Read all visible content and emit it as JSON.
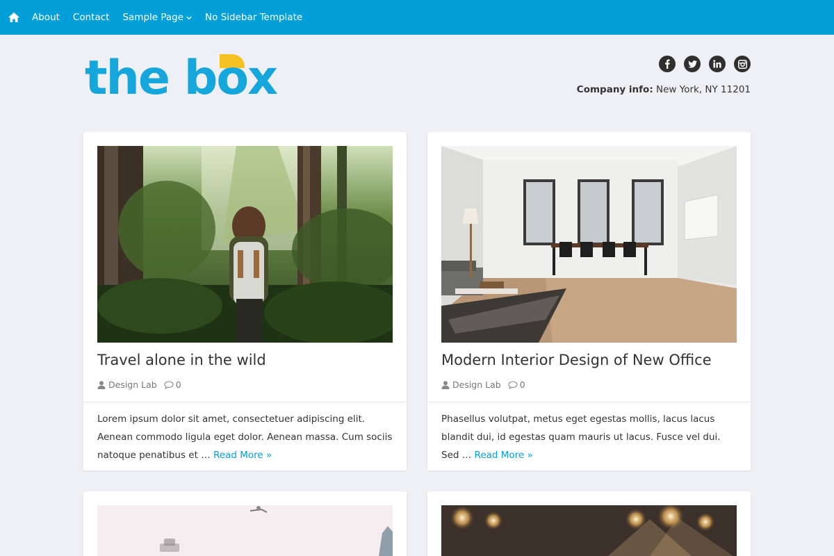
{
  "nav": {
    "home_icon": "home-icon",
    "items": [
      {
        "label": "About"
      },
      {
        "label": "Contact"
      },
      {
        "label": "Sample Page",
        "has_submenu": true
      },
      {
        "label": "No Sidebar Template"
      }
    ]
  },
  "header": {
    "logo_text": "the box",
    "company_label": "Company info:",
    "company_value": "New York, NY 11201",
    "socials": [
      "facebook-icon",
      "twitter-icon",
      "linkedin-icon",
      "instagram-icon"
    ]
  },
  "posts": [
    {
      "title": "Travel alone in the wild",
      "author": "Design Lab",
      "comments": "0",
      "excerpt": "Lorem ipsum dolor sit amet, consectetuer adipiscing elit. Aenean commodo ligula eget dolor. Aenean massa. Cum sociis natoque penatibus et …",
      "read_more": "Read More »"
    },
    {
      "title": "Modern Interior Design of New Office",
      "author": "Design Lab",
      "comments": "0",
      "excerpt": "Phasellus volutpat, metus eget egestas mollis, lacus lacus blandit dui, id egestas quam mauris ut lacus. Fusce vel dui. Sed …",
      "read_more": "Read More »"
    }
  ],
  "colors": {
    "brand": "#029fd8",
    "logo_blue": "#15a7dc",
    "logo_yellow": "#f6c223",
    "background": "#eff0f5"
  }
}
